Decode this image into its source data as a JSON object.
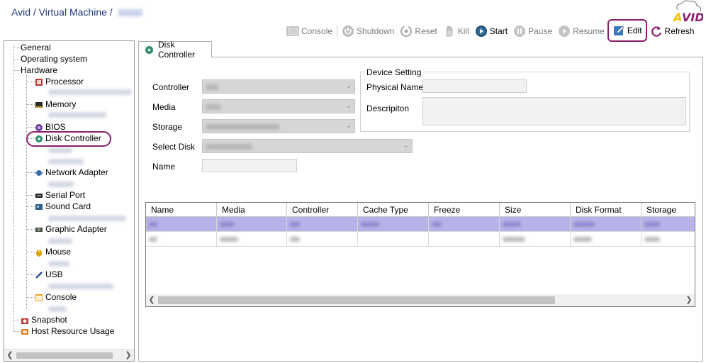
{
  "breadcrumb": {
    "path": "Avid / Virtual Machine / "
  },
  "toolbar": {
    "console": "Console",
    "shutdown": "Shutdown",
    "reset": "Reset",
    "kill": "Kill",
    "start": "Start",
    "pause": "Pause",
    "resume": "Resume",
    "edit": "Edit",
    "refresh": "Refresh"
  },
  "logo": {
    "text": "AVID"
  },
  "tree": {
    "general": "General",
    "os": "Operating system",
    "hardware": "Hardware",
    "processor": "Processor",
    "memory": "Memory",
    "bios": "BIOS",
    "disk_controller": "Disk Controller",
    "network_adapter": "Network Adapter",
    "serial_port": "Serial Port",
    "sound_card": "Sound Card",
    "graphic_adapter": "Graphic Adapter",
    "mouse": "Mouse",
    "usb": "USB",
    "console": "Console",
    "snapshot": "Snapshot",
    "host_resource": "Host Resource Usage"
  },
  "tab": {
    "label": "Disk Controller"
  },
  "form": {
    "controller": "Controller",
    "media": "Media",
    "storage": "Storage",
    "select_disk": "Select Disk",
    "name": "Name"
  },
  "device_setting": {
    "title": "Device Setting",
    "physical_name": "Physical Name",
    "description": "Descripiton"
  },
  "grid": {
    "columns": [
      "Name",
      "Media",
      "Controller",
      "Cache Type",
      "Freeze",
      "Size",
      "Disk Format",
      "Storage"
    ]
  },
  "colors": {
    "accent": "#8a1e6e",
    "breadcrumb": "#1f3a7a",
    "selected_row": "#b5b3e8"
  }
}
